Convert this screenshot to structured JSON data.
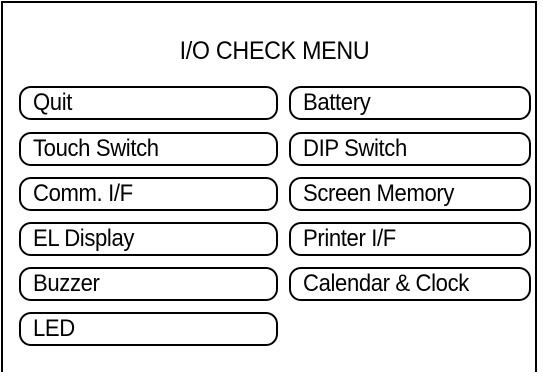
{
  "menu": {
    "title": "I/O CHECK MENU",
    "left_buttons": [
      {
        "label": "Quit"
      },
      {
        "label": "Touch Switch"
      },
      {
        "label": "Comm. I/F"
      },
      {
        "label": "EL Display"
      },
      {
        "label": "Buzzer"
      },
      {
        "label": "LED"
      }
    ],
    "right_buttons": [
      {
        "label": "Battery"
      },
      {
        "label": "DIP Switch"
      },
      {
        "label": "Screen Memory"
      },
      {
        "label": "Printer I/F"
      },
      {
        "label": "Calendar & Clock"
      }
    ]
  },
  "colors": {
    "background": "#ffffff",
    "border": "#000000",
    "text": "#000000"
  }
}
